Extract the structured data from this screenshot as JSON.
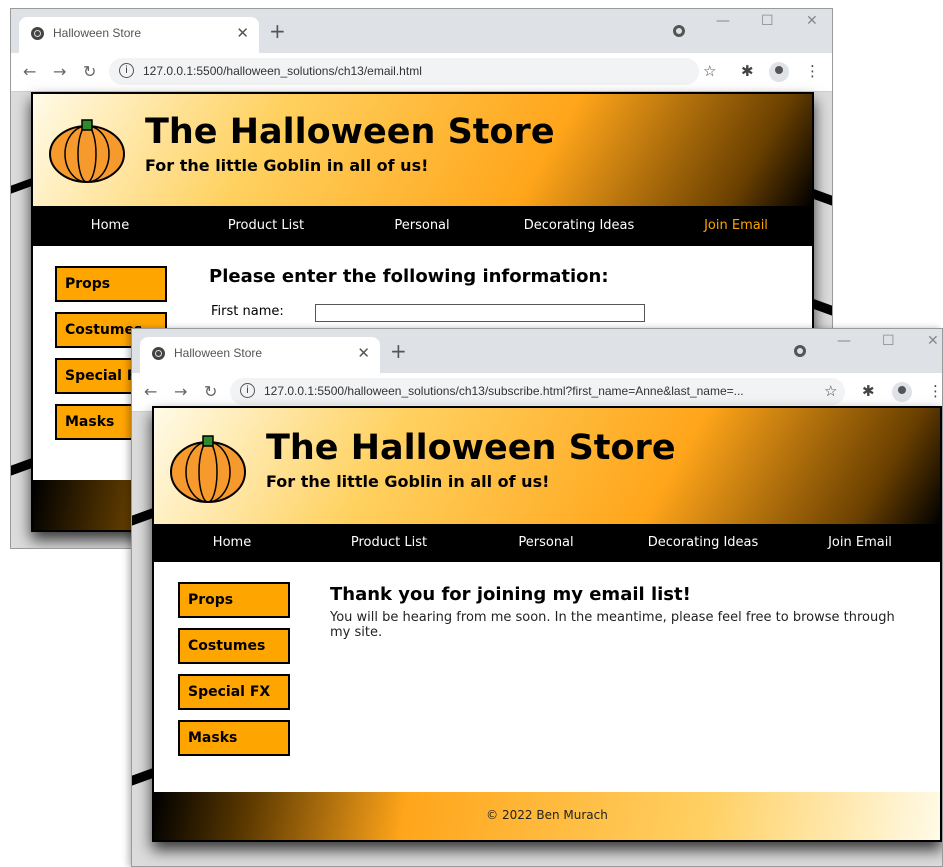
{
  "windows": [
    {
      "tab_title": "Halloween Store",
      "url": "127.0.0.1:5500/halloween_solutions/ch13/email.html",
      "header": {
        "title": "The Halloween Store",
        "tagline": "For the little Goblin in all of us!"
      },
      "nav": [
        {
          "label": "Home"
        },
        {
          "label": "Product List"
        },
        {
          "label": "Personal"
        },
        {
          "label": "Decorating Ideas"
        },
        {
          "label": "Join Email",
          "current": true
        }
      ],
      "sidebar": [
        "Props",
        "Costumes",
        "Special FX",
        "Masks"
      ],
      "main": {
        "heading": "Please enter the following information:",
        "first_name_label": "First name:",
        "first_name_value": ""
      }
    },
    {
      "tab_title": "Halloween Store",
      "url": "127.0.0.1:5500/halloween_solutions/ch13/subscribe.html?first_name=Anne&last_name=...",
      "header": {
        "title": "The Halloween Store",
        "tagline": "For the little Goblin in all of us!"
      },
      "nav": [
        {
          "label": "Home"
        },
        {
          "label": "Product List"
        },
        {
          "label": "Personal"
        },
        {
          "label": "Decorating Ideas"
        },
        {
          "label": "Join Email"
        }
      ],
      "sidebar": [
        "Props",
        "Costumes",
        "Special FX",
        "Masks"
      ],
      "main": {
        "heading": "Thank you for joining my email list!",
        "message": "You will be hearing from me soon. In the meantime, please feel free to browse through my site."
      },
      "footer": "© 2022 Ben Murach"
    }
  ],
  "colors": {
    "accent_orange": "#ffa500",
    "nav_bg": "#000000",
    "active_nav": "#ffa500"
  },
  "icons": [
    "globe-icon",
    "close-icon",
    "plus-icon",
    "back-icon",
    "forward-icon",
    "reload-icon",
    "info-icon",
    "star-icon",
    "puzzle-icon",
    "avatar-icon",
    "menu-icon",
    "pumpkin-icon"
  ]
}
